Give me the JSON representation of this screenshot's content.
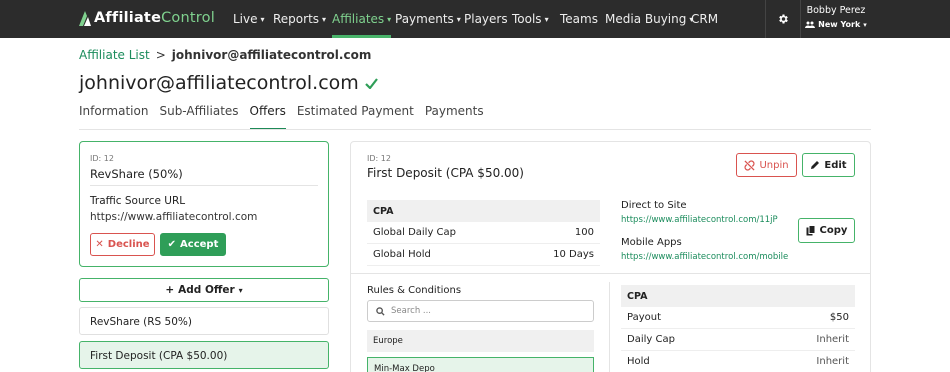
{
  "brand": {
    "part1": "Affiliate",
    "part2": "Control"
  },
  "nav": [
    {
      "label": "Live",
      "caret": "▾"
    },
    {
      "label": "Reports",
      "caret": "▾"
    },
    {
      "label": "Affiliates",
      "caret": "▾",
      "active": true
    },
    {
      "label": "Payments",
      "caret": "▾"
    },
    {
      "label": "Players",
      "caret": ""
    },
    {
      "label": "Tools",
      "caret": "▾"
    },
    {
      "label": "Teams",
      "caret": ""
    },
    {
      "label": "Media Buying",
      "caret": "▾"
    },
    {
      "label": "CRM",
      "caret": ""
    }
  ],
  "user": {
    "name": "Bobby Perez",
    "location": "New York"
  },
  "breadcrumb": {
    "parent": "Affiliate List",
    "sep": ">",
    "current": "johnivor@affiliatecontrol.com"
  },
  "page_title": "johnivor@affiliatecontrol.com",
  "tabs": [
    "Information",
    "Sub-Affiliates",
    "Offers",
    "Estimated Payment",
    "Payments"
  ],
  "active_tab": "Offers",
  "pending_offer": {
    "id": "ID: 12",
    "name": "RevShare (50%)",
    "field_label": "Traffic Source URL",
    "url": "https://www.affiliatecontrol.com",
    "decline": "Decline",
    "accept": "Accept"
  },
  "add_offer": "Add Offer",
  "offer_list": [
    "RevShare (RS 50%)",
    "First Deposit (CPA $50.00)"
  ],
  "detail": {
    "id": "ID: 12",
    "name": "First Deposit (CPA $50.00)",
    "unpin": "Unpin",
    "edit": "Edit",
    "cpa_header": "CPA",
    "cpa_rows": [
      {
        "label": "Global Daily Cap",
        "value": "100"
      },
      {
        "label": "Global Hold",
        "value": "10 Days"
      }
    ],
    "direct_label": "Direct to Site",
    "direct_url": "https://www.affiliatecontrol.com/11jP",
    "mobile_label": "Mobile Apps",
    "mobile_url": "https://www.affiliatecontrol.com/mobile",
    "copy": "Copy",
    "rules_label": "Rules & Conditions",
    "search_placeholder": "Search ...",
    "region": "Europe",
    "rule": "Min-Max Depo",
    "cpa2_header": "CPA",
    "cpa2_rows": [
      {
        "label": "Payout",
        "value": "$50"
      },
      {
        "label": "Daily Cap",
        "value": "Inherit"
      },
      {
        "label": "Hold",
        "value": "Inherit"
      }
    ]
  }
}
